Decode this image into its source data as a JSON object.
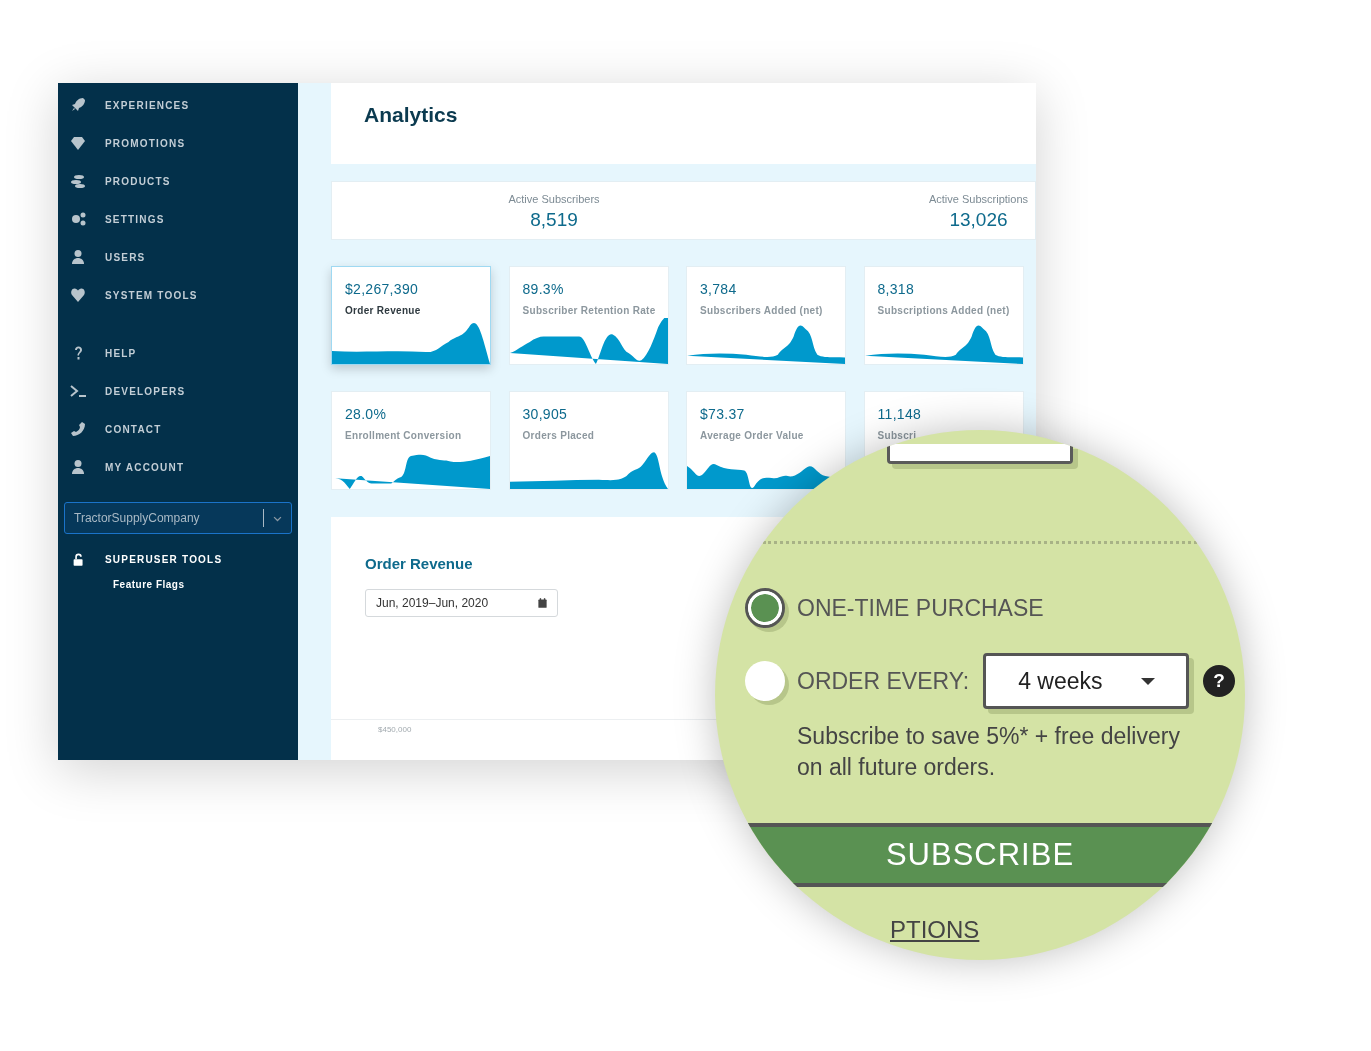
{
  "sidebar": {
    "nav_groups": [
      {
        "items": [
          "EXPERIENCES",
          "PROMOTIONS",
          "PRODUCTS",
          "SETTINGS",
          "USERS",
          "SYSTEM TOOLS"
        ]
      },
      {
        "items": [
          "HELP",
          "DEVELOPERS",
          "CONTACT",
          "MY ACCOUNT"
        ]
      }
    ],
    "account_select": {
      "value": "TractorSupplyCompany"
    },
    "superuser": {
      "title": "SUPERUSER TOOLS",
      "items": [
        "Feature Flags"
      ]
    }
  },
  "page_title": "Analytics",
  "summary": [
    {
      "label": "Active Subscribers",
      "value": "8,519"
    },
    {
      "label": "Active Subscriptions",
      "value": "13,026"
    }
  ],
  "metric_cards": [
    {
      "value": "$2,267,390",
      "label": "Order Revenue",
      "selected": true
    },
    {
      "value": "89.3%",
      "label": "Subscriber Retention Rate",
      "selected": false
    },
    {
      "value": "3,784",
      "label": "Subscribers Added (net)",
      "selected": false
    },
    {
      "value": "8,318",
      "label": "Subscriptions Added (net)",
      "selected": false
    },
    {
      "value": "28.0%",
      "label": "Enrollment Conversion",
      "selected": false
    },
    {
      "value": "30,905",
      "label": "Orders Placed",
      "selected": false
    },
    {
      "value": "$73.37",
      "label": "Average Order Value",
      "selected": false
    },
    {
      "value": "11,148",
      "label": "Subscri",
      "selected": false
    }
  ],
  "order_revenue_panel": {
    "title": "Order Revenue",
    "date_range": "Jun, 2019–Jun, 2020",
    "axis_label": "$450,000"
  },
  "magnifier": {
    "options": [
      {
        "label": "ONE-TIME PURCHASE",
        "selected": true
      },
      {
        "label": "ORDER EVERY:",
        "selected": false
      }
    ],
    "frequency": "4 weeks",
    "help": "?",
    "note": "Subscribe to save 5%* + free delivery on all future orders.",
    "subscribe_button": "SUBSCRIBE",
    "options_link": "PTIONS"
  }
}
